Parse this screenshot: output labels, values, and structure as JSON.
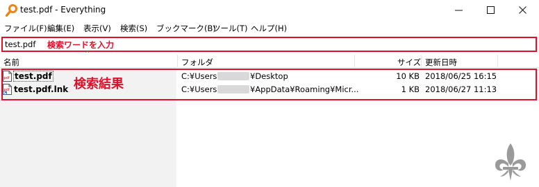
{
  "window": {
    "title": "test.pdf - Everything",
    "controls": {
      "minimize": "–",
      "maximize": "☐",
      "close": "✕"
    }
  },
  "menu": [
    "ファイル(F)",
    "編集(E)",
    "表示(V)",
    "検索(S)",
    "ブックマーク(B)",
    "ツール(T)",
    "ヘルプ(H)"
  ],
  "search": {
    "value": "test.pdf",
    "annotation": "検索ワードを入力"
  },
  "columns": {
    "name": "名前",
    "folder": "フォルダ",
    "size": "サイズ",
    "modified": "更新日時",
    "sort_indicator": "^"
  },
  "results_annotation": "検索結果",
  "results": [
    {
      "name": "test.pdf",
      "icon": "pdf-file-icon",
      "folder_prefix": "C:¥Users¥",
      "folder_suffix": "¥Desktop",
      "size": "10 KB",
      "modified": "2018/06/25 16:15"
    },
    {
      "name": "test.pdf.lnk",
      "icon": "pdf-shortcut-icon",
      "folder_prefix": "C:¥Users¥",
      "folder_suffix": "¥AppData¥Roaming¥Micr...",
      "size": "1 KB",
      "modified": "2018/06/27 11:13"
    }
  ],
  "colors": {
    "annotation_red": "#e0102a",
    "left_pane": "#f2f2f2",
    "app_icon_orange": "#e8841a"
  },
  "watermark": "fleur-de-lis-icon"
}
